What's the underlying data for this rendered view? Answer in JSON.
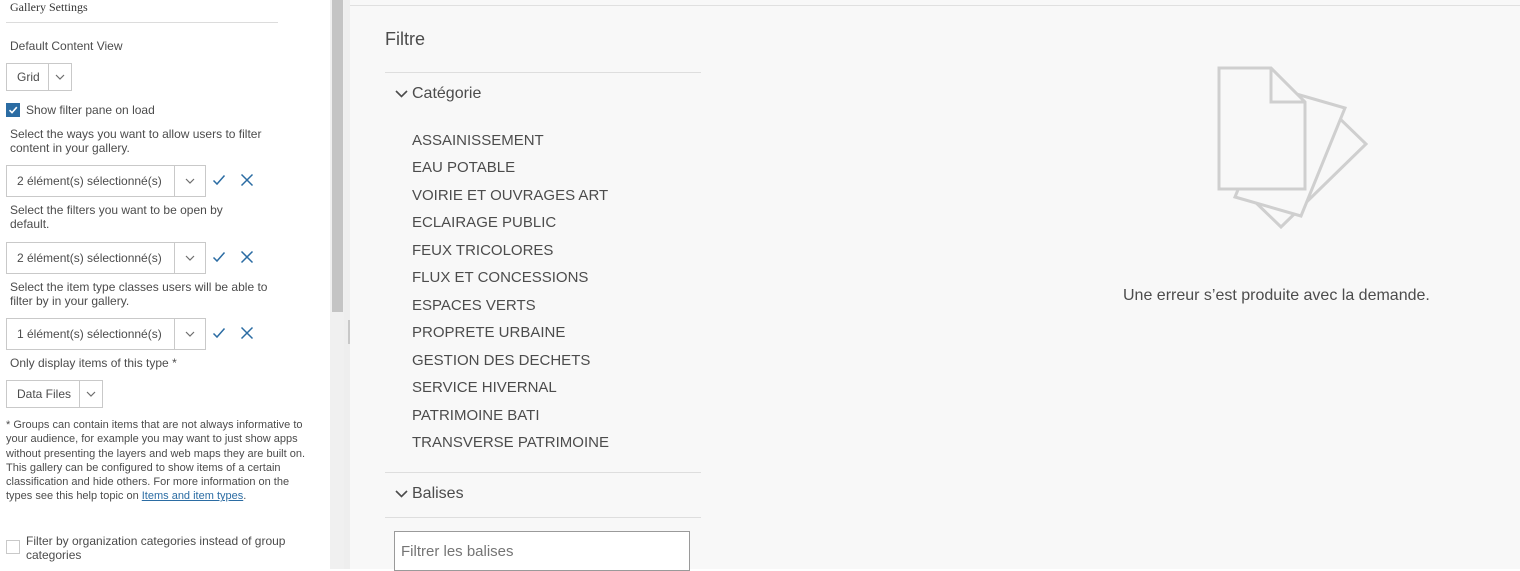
{
  "settings": {
    "title": "Gallery Settings",
    "default_view_label": "Default Content View",
    "default_view_value": "Grid",
    "show_filter_label": "Show filter pane on load",
    "show_filter_checked": true,
    "filter_ways_label": "Select the ways you want to allow users to filter content in your gallery.",
    "filter_ways_value": "2 élément(s) sélectionné(s)",
    "open_filters_label": "Select the filters you want to be open by default.",
    "open_filters_value": "2 élément(s) sélectionné(s)",
    "item_classes_label": "Select the item type classes users will be able to filter by in your gallery.",
    "item_classes_value": "1 élément(s) sélectionné(s)",
    "only_display_label": "Only display items of this type *",
    "only_display_value": "Data Files",
    "note_text": "* Groups can contain items that are not always informative to your audience, for example you may want to just show apps without presenting the layers and web maps they are built on. This gallery can be configured to show items of a certain classification and hide others. For more information on the types see this help topic on ",
    "note_link": "Items and item types",
    "note_end": ".",
    "org_categories_label": "Filter by organization categories instead of group categories",
    "org_categories_checked": false
  },
  "filter_pane": {
    "title": "Filtre",
    "category_header": "Catégorie",
    "categories": [
      "ASSAINISSEMENT",
      "EAU POTABLE",
      "VOIRIE ET OUVRAGES ART",
      "ECLAIRAGE PUBLIC",
      "FEUX TRICOLORES",
      "FLUX ET CONCESSIONS",
      "ESPACES VERTS",
      "PROPRETE URBAINE",
      "GESTION DES DECHETS",
      "SERVICE HIVERNAL",
      "PATRIMOINE BATI",
      "TRANSVERSE PATRIMOINE"
    ],
    "tags_header": "Balises",
    "tags_placeholder": "Filtrer les balises"
  },
  "content": {
    "error_message": "Une erreur s’est produite avec la demande."
  },
  "colors": {
    "accent": "#2b6ca3",
    "text": "#4c4c4c",
    "panel_bg": "#f8f8f8"
  },
  "icons": {
    "chevron": "chevron-down-icon",
    "apply": "check-icon",
    "clear": "close-icon",
    "empty": "documents-icon"
  }
}
